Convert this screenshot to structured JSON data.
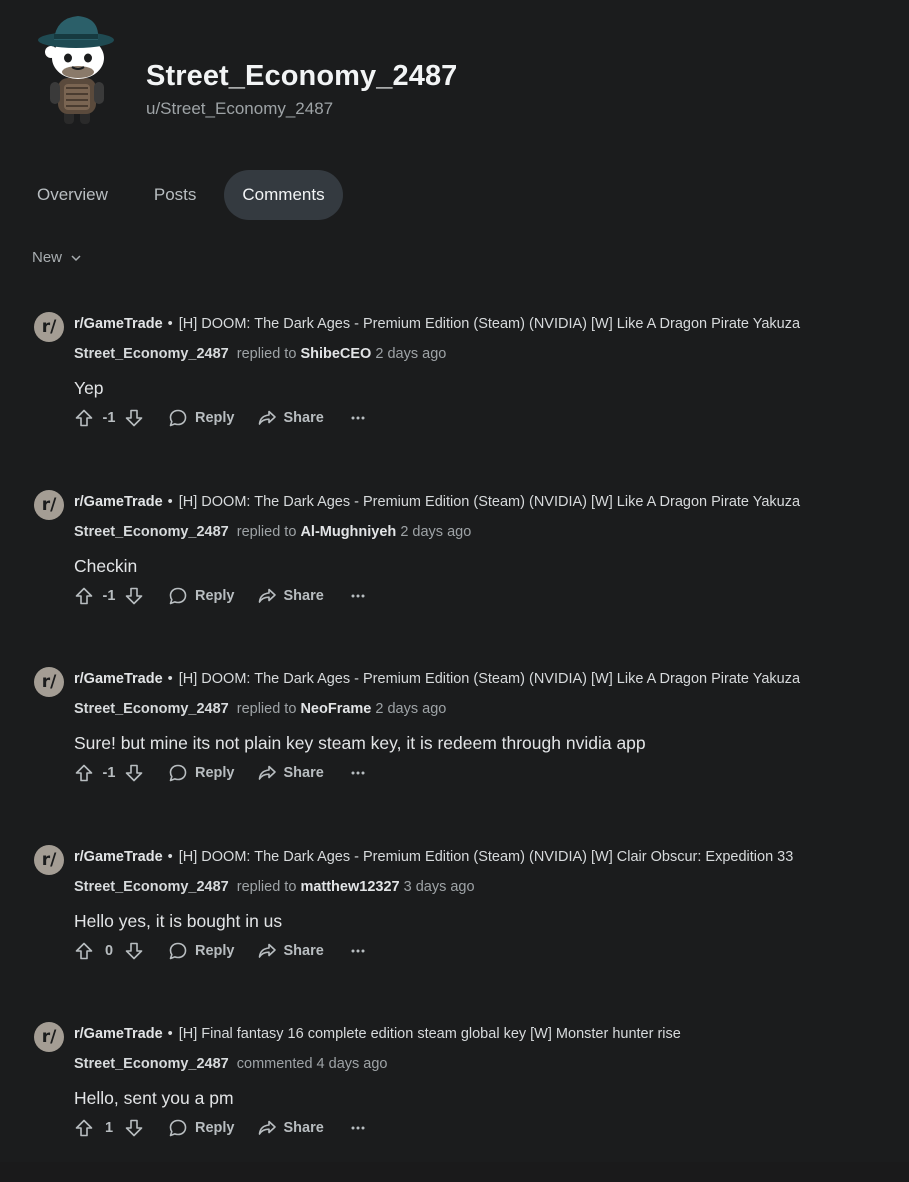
{
  "profile": {
    "display_name": "Street_Economy_2487",
    "username": "u/Street_Economy_2487"
  },
  "tabs": [
    {
      "label": "Overview",
      "active": false
    },
    {
      "label": "Posts",
      "active": false
    },
    {
      "label": "Comments",
      "active": true
    }
  ],
  "sort": {
    "label": "New"
  },
  "comments": [
    {
      "subreddit": "r/GameTrade",
      "post_title": "[H] DOOM: The Dark Ages - Premium Edition (Steam) (NVIDIA) [W] Like A Dragon Pirate Yakuza",
      "author": "Street_Economy_2487",
      "action": "replied to",
      "target": "ShibeCEO",
      "time": "2 days ago",
      "body": "Yep",
      "score": "-1",
      "reply_label": "Reply",
      "share_label": "Share"
    },
    {
      "subreddit": "r/GameTrade",
      "post_title": "[H] DOOM: The Dark Ages - Premium Edition (Steam) (NVIDIA) [W] Like A Dragon Pirate Yakuza",
      "author": "Street_Economy_2487",
      "action": "replied to",
      "target": "Al-Mughniyeh",
      "time": "2 days ago",
      "body": "Checkin",
      "score": "-1",
      "reply_label": "Reply",
      "share_label": "Share"
    },
    {
      "subreddit": "r/GameTrade",
      "post_title": "[H] DOOM: The Dark Ages - Premium Edition (Steam) (NVIDIA) [W] Like A Dragon Pirate Yakuza",
      "author": "Street_Economy_2487",
      "action": "replied to",
      "target": "NeoFrame",
      "time": "2 days ago",
      "body": "Sure! but mine its not plain key steam key, it is redeem through nvidia app",
      "score": "-1",
      "reply_label": "Reply",
      "share_label": "Share"
    },
    {
      "subreddit": "r/GameTrade",
      "post_title": "[H] DOOM: The Dark Ages - Premium Edition (Steam) (NVIDIA) [W] Clair Obscur: Expedition 33",
      "author": "Street_Economy_2487",
      "action": "replied to",
      "target": "matthew12327",
      "time": "3 days ago",
      "body": "Hello yes, it is bought in us",
      "score": "0",
      "reply_label": "Reply",
      "share_label": "Share"
    },
    {
      "subreddit": "r/GameTrade",
      "post_title": "[H] Final fantasy 16 complete edition steam global key [W] Monster hunter rise",
      "author": "Street_Economy_2487",
      "action": "commented",
      "target": "",
      "time": "4 days ago",
      "body": "Hello, sent you a pm",
      "score": "1",
      "reply_label": "Reply",
      "share_label": "Share"
    }
  ],
  "colors": {
    "background": "#1b1c1d",
    "active_tab": "#343a40",
    "subreddit_icon": "#a49d94"
  }
}
